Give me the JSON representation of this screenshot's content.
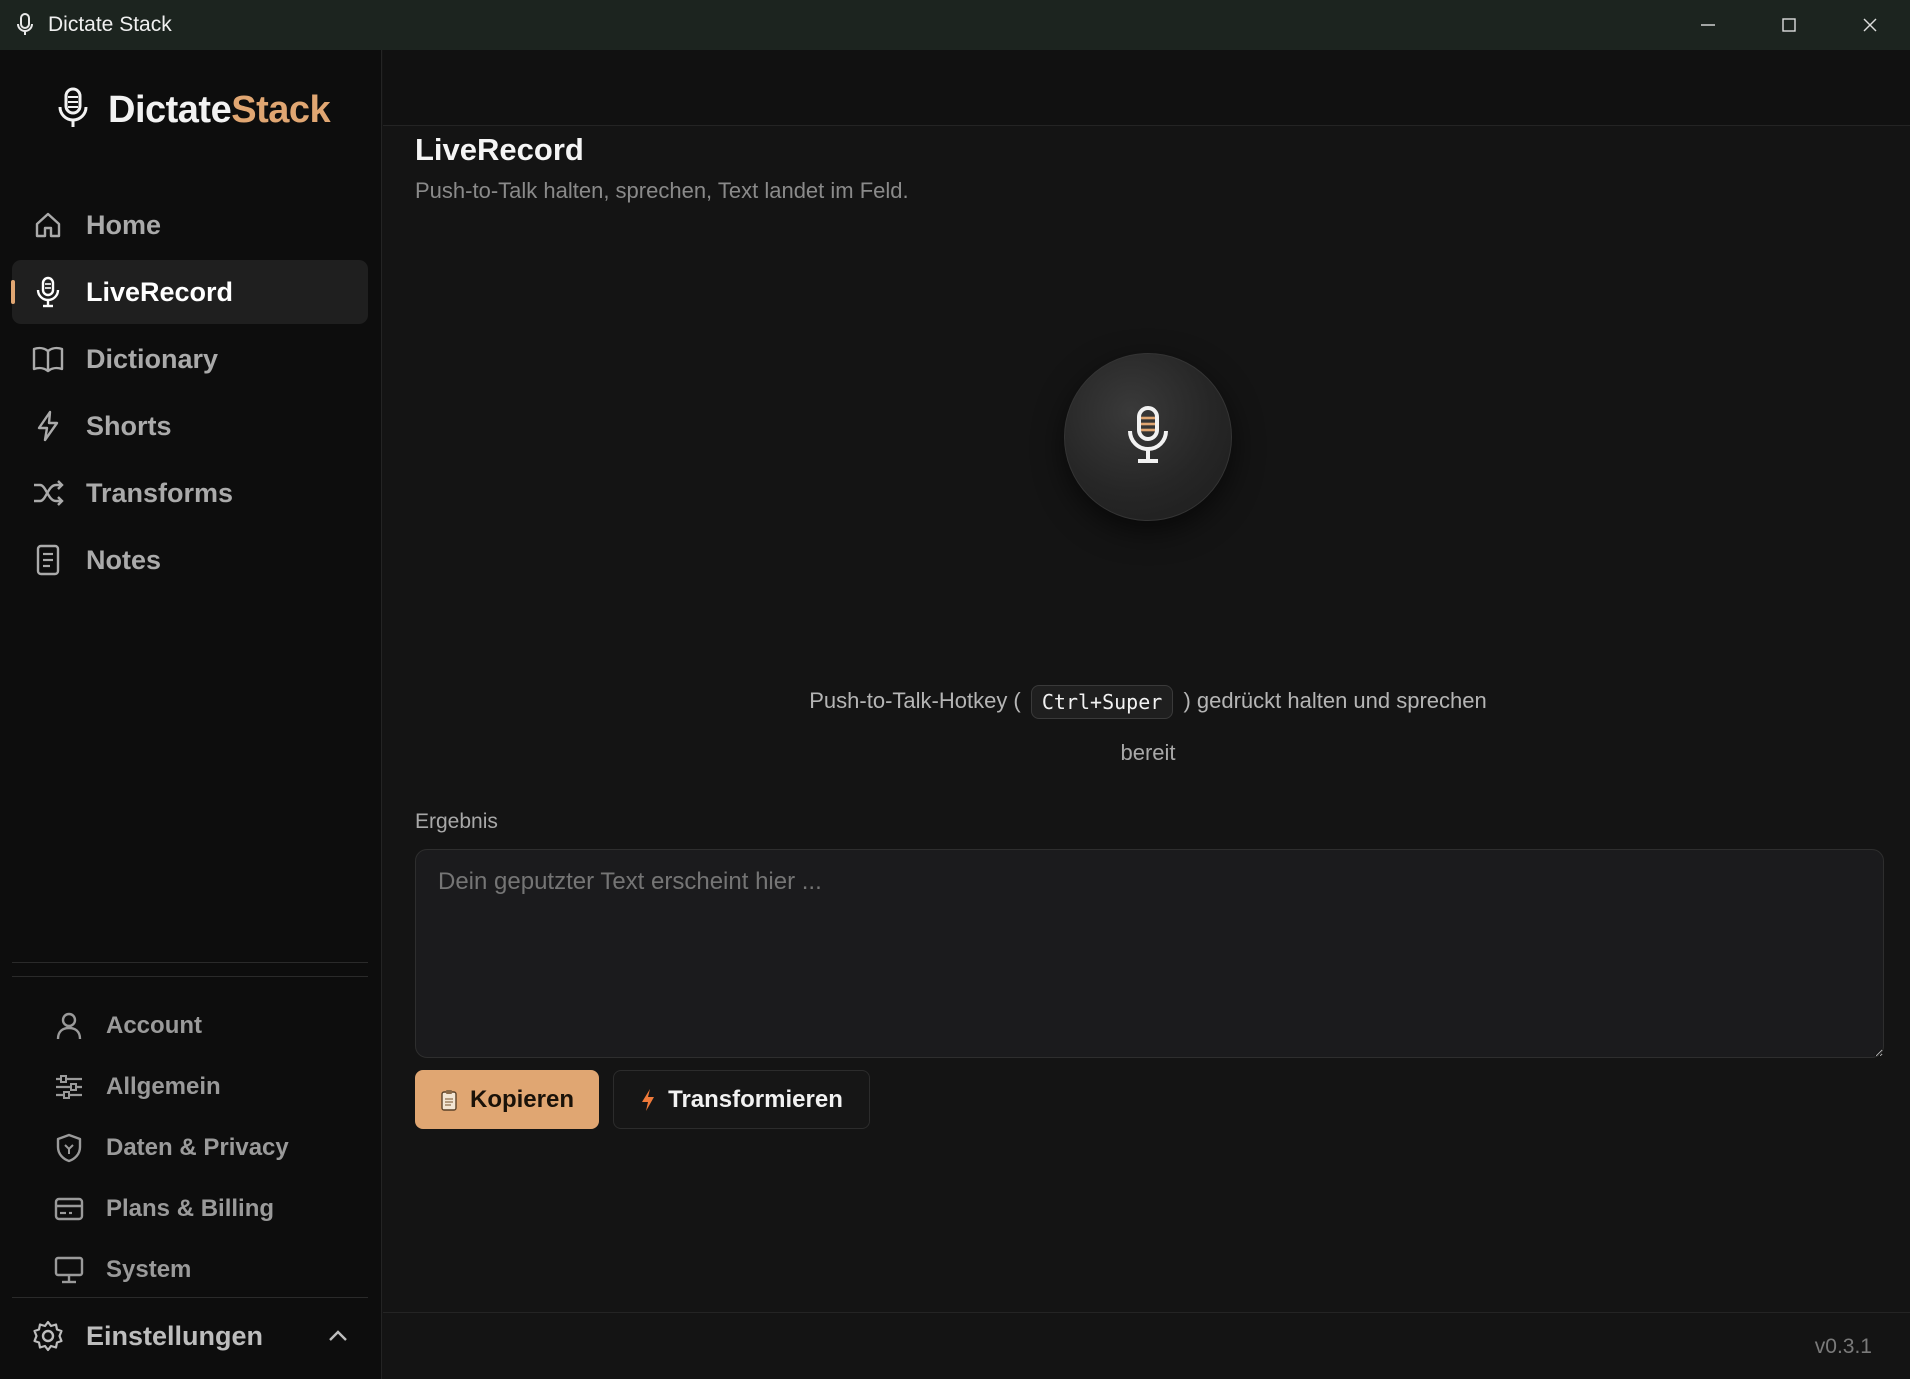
{
  "window": {
    "title": "Dictate Stack",
    "controls": {
      "minimize": "minimize-icon",
      "maximize": "maximize-icon",
      "close": "close-icon"
    }
  },
  "brand": {
    "part1": "Dictate",
    "part2": "Stack",
    "accent_color": "#e0a672"
  },
  "nav": {
    "active": "LiveRecord",
    "items": [
      {
        "label": "Home",
        "icon": "home-icon"
      },
      {
        "label": "LiveRecord",
        "icon": "microphone-icon"
      },
      {
        "label": "Dictionary",
        "icon": "book-icon"
      },
      {
        "label": "Shorts",
        "icon": "lightning-icon"
      },
      {
        "label": "Transforms",
        "icon": "shuffle-icon"
      },
      {
        "label": "Notes",
        "icon": "note-icon"
      }
    ]
  },
  "settings": {
    "label": "Einstellungen",
    "expanded": true,
    "items": [
      {
        "label": "Account",
        "icon": "user-icon"
      },
      {
        "label": "Allgemein",
        "icon": "sliders-icon"
      },
      {
        "label": "Daten & Privacy",
        "icon": "shield-icon"
      },
      {
        "label": "Plans & Billing",
        "icon": "credit-card-icon"
      },
      {
        "label": "System",
        "icon": "monitor-icon"
      }
    ]
  },
  "main": {
    "title": "LiveRecord",
    "subtitle": "Push-to-Talk halten, sprechen, Text landet im Feld.",
    "hint_before": "Push-to-Talk-Hotkey (",
    "hotkey": "Ctrl+Super",
    "hint_after": ") gedrückt halten und sprechen",
    "status": "bereit",
    "result_label": "Ergebnis",
    "result_placeholder": "Dein geputzter Text erscheint hier ...",
    "result_value": "",
    "copy_label": "Kopieren",
    "transform_label": "Transformieren"
  },
  "footer": {
    "version": "v0.3.1"
  }
}
